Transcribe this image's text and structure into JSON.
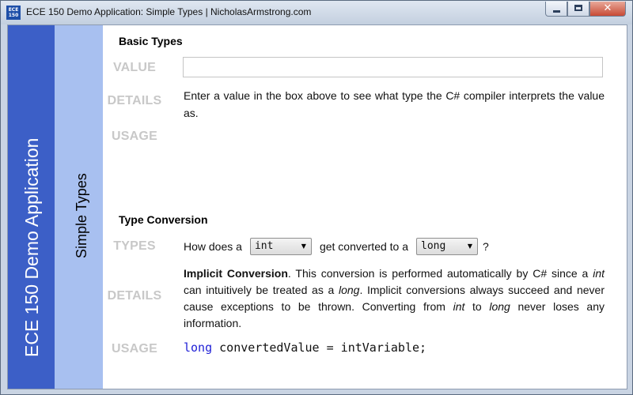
{
  "window": {
    "title": "ECE 150 Demo Application: Simple Types | NicholasArmstrong.com",
    "icon_text": "ECE 150",
    "icon": "app-logo-icon",
    "minimize_icon": "minimize-icon",
    "maximize_icon": "maximize-icon",
    "close_icon": "close-icon",
    "close_glyph": "✕"
  },
  "sidebar": {
    "app_name": "ECE 150 Demo Application",
    "section_name": "Simple Types"
  },
  "basic_types": {
    "heading": "Basic Types",
    "value_label": "VALUE",
    "value_input": "",
    "details_label": "DETAILS",
    "details_text": "Enter a value in the box above to see what type the C# compiler interprets the value as.",
    "usage_label": "USAGE",
    "usage_text": ""
  },
  "type_conversion": {
    "heading": "Type Conversion",
    "types_label": "TYPES",
    "prompt_before": "How does a",
    "from_type": "int",
    "prompt_middle": "get converted to a",
    "to_type": "long",
    "prompt_after": "?",
    "dropdown_icon": "dropdown-arrow-icon",
    "details_label": "DETAILS",
    "conversion_kind": "Implicit Conversion",
    "sentence_1_a": ". This conversion is performed automatically by C# since a ",
    "sentence_1_type_a": "int",
    "sentence_1_b": " can intuitively be treated as a ",
    "sentence_1_type_b": "long",
    "sentence_1_c": ".  Implicit conversions always succeed and never cause exceptions to be thrown.  Converting from ",
    "sentence_2_type_a": "int",
    "sentence_2_b": " to ",
    "sentence_2_type_b": "long",
    "sentence_2_c": " never loses any information.",
    "usage_label": "USAGE",
    "code_keyword": "long",
    "code_rest": " convertedValue = intVariable;"
  },
  "colors": {
    "sidebar_dark": "#3c5fc7",
    "sidebar_light": "#a8c0f0",
    "label_gray": "#c8c8c8",
    "code_keyword": "#1f1fd6"
  }
}
